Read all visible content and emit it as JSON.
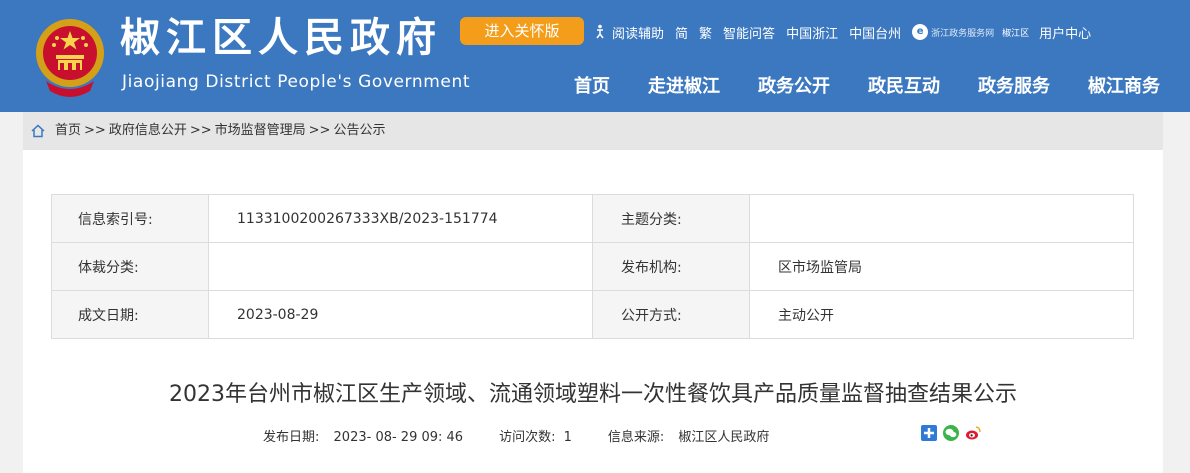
{
  "header": {
    "title": "椒江区人民政府",
    "subtitle": "Jiaojiang District People's Government",
    "care_button": "进入关怀版",
    "utility": {
      "reading_aid": "阅读辅助",
      "simplified": "简",
      "traditional": "繁",
      "smart_qa": "智能问答",
      "china_zhejiang": "中国浙江",
      "china_taizhou": "中国台州",
      "zjzw_logo_text": "浙江政务服务网",
      "zjzw_sub": "椒江区",
      "user_center": "用户中心"
    },
    "nav": [
      "首页",
      "走进椒江",
      "政务公开",
      "政民互动",
      "政务服务",
      "椒江商务"
    ]
  },
  "breadcrumb": {
    "items": [
      "首页",
      "政府信息公开",
      "市场监督管理局",
      "公告公示"
    ],
    "separator": ">>"
  },
  "meta": {
    "rows": [
      {
        "label1": "信息索引号:",
        "value1": "1133100200267333XB/2023-151774",
        "label2": "主题分类:",
        "value2": ""
      },
      {
        "label1": "体裁分类:",
        "value1": "",
        "label2": "发布机构:",
        "value2": "区市场监管局"
      },
      {
        "label1": "成文日期:",
        "value1": "2023-08-29",
        "label2": "公开方式:",
        "value2": "主动公开"
      }
    ]
  },
  "article": {
    "title": "2023年台州市椒江区生产领域、流通领域塑料一次性餐饮具产品质量监督抽查结果公示",
    "publish_label": "发布日期:",
    "publish_value": "2023- 08- 29 09: 46",
    "visits_label": "访问次数:",
    "visits_value": "1",
    "source_label": "信息来源:",
    "source_value": "椒江区人民政府"
  },
  "colors": {
    "header_bg": "#3b78c0",
    "care_button": "#f39d1a",
    "breadcrumb_bg": "#e6e6e6"
  },
  "icons": {
    "emblem": "national-emblem",
    "reading_aid": "accessibility-icon",
    "home": "home-icon",
    "share": [
      "plus-share-icon",
      "wechat-icon",
      "weibo-icon"
    ]
  }
}
